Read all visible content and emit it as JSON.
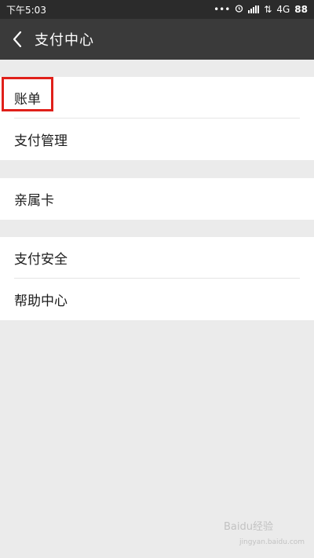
{
  "status_bar": {
    "time": "下午5:03",
    "dots": "•••",
    "network": "4G",
    "battery": "88"
  },
  "app_bar": {
    "title": "支付中心"
  },
  "sections": [
    {
      "items": [
        {
          "label": "账单"
        },
        {
          "label": "支付管理"
        }
      ]
    },
    {
      "items": [
        {
          "label": "亲属卡"
        }
      ]
    },
    {
      "items": [
        {
          "label": "支付安全"
        },
        {
          "label": "帮助中心"
        }
      ]
    }
  ],
  "colors": {
    "highlight": "#e0201a",
    "appbar": "#3a3a3a",
    "statusbar": "#2b2b2b",
    "background": "#ebebeb"
  },
  "watermark": {
    "text": "Baidu经验",
    "sub": "jingyan.baidu.com"
  }
}
